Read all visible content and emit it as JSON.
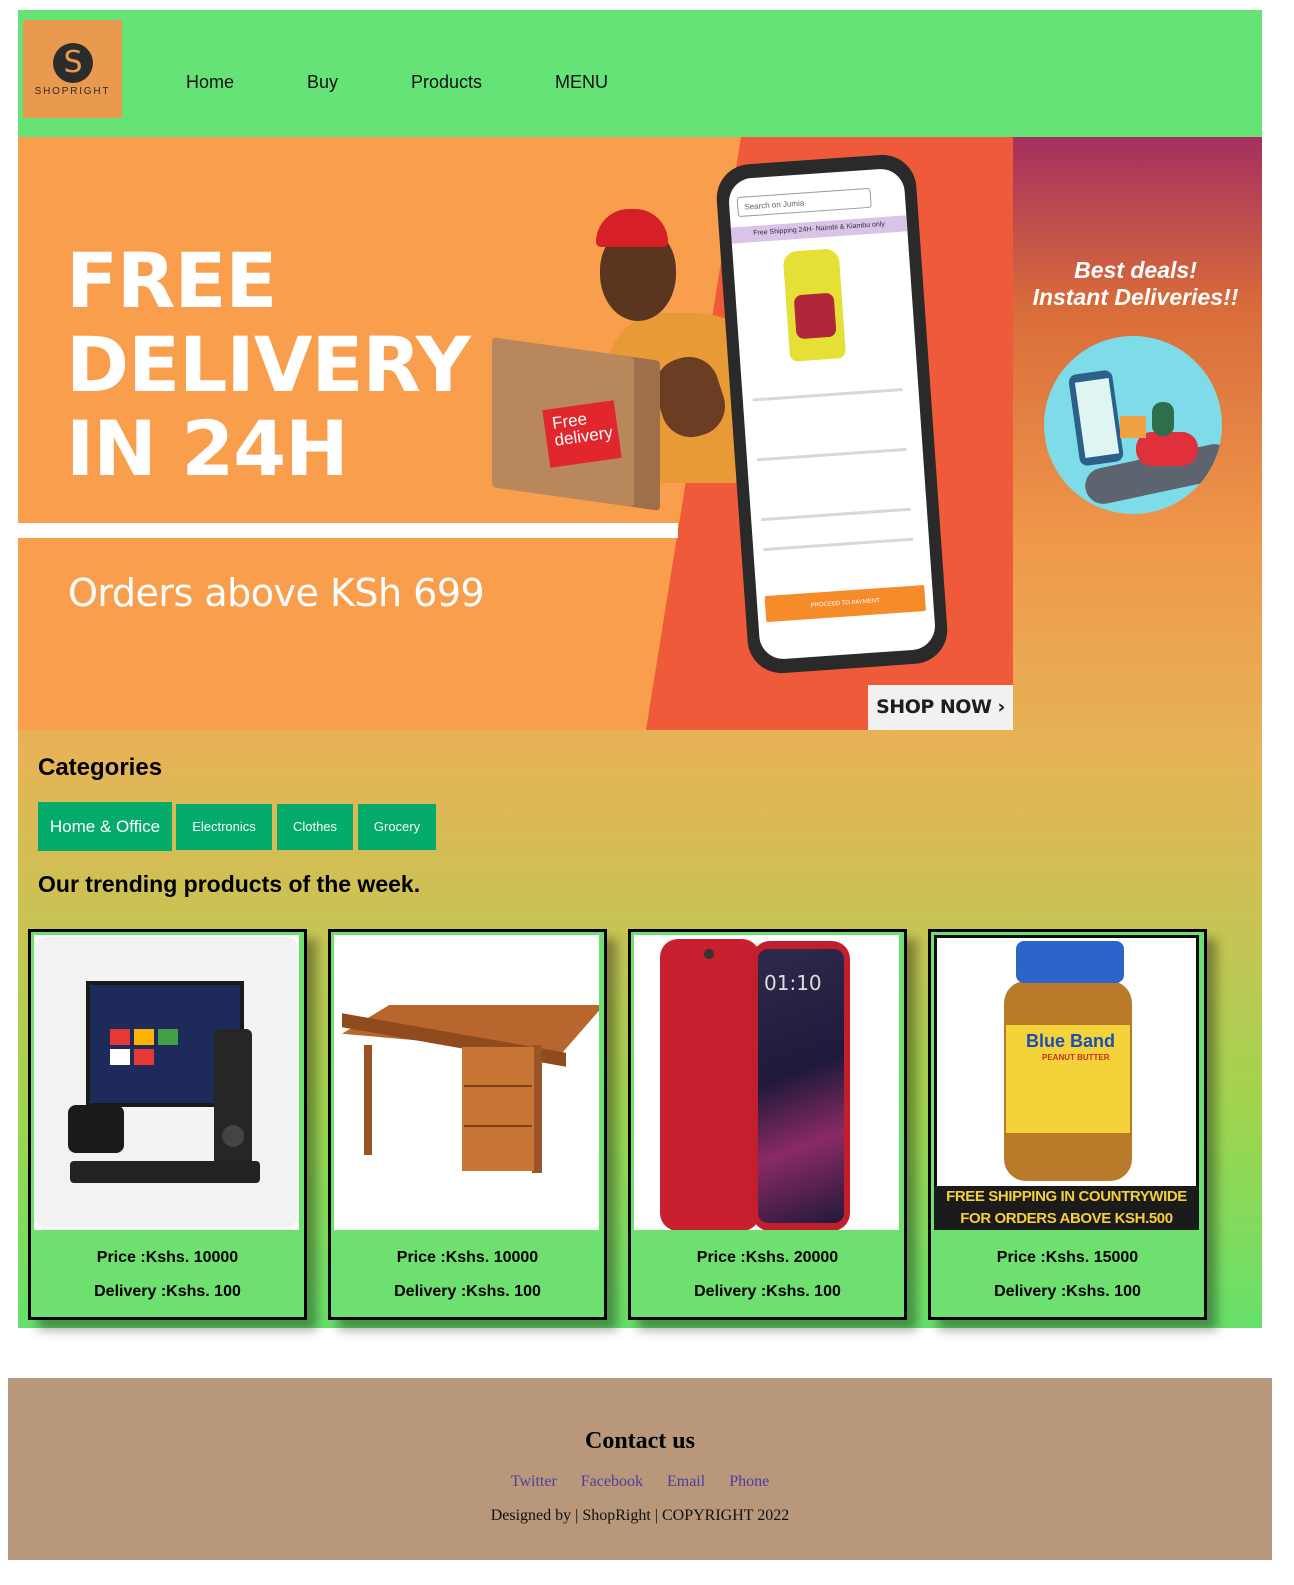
{
  "brand": {
    "logo_letter": "S",
    "logo_text": "SHOPRIGHT"
  },
  "nav": {
    "items": [
      "Home",
      "Buy",
      "Products",
      "MENU"
    ]
  },
  "hero": {
    "headline": [
      "FREE",
      "DELIVERY",
      "IN 24H"
    ],
    "subline": "Orders above KSh 699",
    "box_tag": [
      "Free",
      "delivery"
    ],
    "phone_screen": {
      "search_placeholder": "Search on Jumia",
      "promo_bar": "Free Shipping 24H- Nairobi & Kiambu only",
      "button": "PROCEED TO PAYMENT"
    },
    "cta": "SHOP NOW ›"
  },
  "promo": {
    "lines": [
      "Best deals!",
      "Instant Deliveries!!"
    ]
  },
  "categories": {
    "title": "Categories",
    "items": [
      "Home & Office",
      "Electronics",
      "Clothes",
      "Grocery"
    ]
  },
  "trending": {
    "title": "Our trending products of the week.",
    "products": [
      {
        "image": "tv-set",
        "price": "Price :Kshs. 10000",
        "delivery": "Delivery :Kshs. 100"
      },
      {
        "image": "office-desk",
        "price": "Price :Kshs. 10000",
        "delivery": "Delivery :Kshs. 100"
      },
      {
        "image": "oppo-phone",
        "price": "Price :Kshs. 20000",
        "delivery": "Delivery :Kshs. 100",
        "screen_time": "01:10"
      },
      {
        "image": "peanut-butter-jar",
        "price": "Price :Kshs. 15000",
        "delivery": "Delivery :Kshs. 100",
        "jar_brand": "Blue Band",
        "jar_sub": "PEANUT BUTTER",
        "banner": [
          "FREE SHIPPING IN COUNTRYWIDE",
          "FOR ORDERS ABOVE KSH.500"
        ]
      }
    ]
  },
  "footer": {
    "title": "Contact us",
    "links": [
      "Twitter",
      "Facebook",
      "Email",
      "Phone"
    ],
    "credit": "Designed by | ShopRight | COPYRIGHT 2022"
  },
  "colors": {
    "header_bg": "#66e376",
    "logo_bg": "#ea9a4f",
    "category_button": "#05ab6a",
    "card_bg": "#6ee06f",
    "footer_bg": "#b8977a",
    "footer_link": "#4b3e9e"
  }
}
